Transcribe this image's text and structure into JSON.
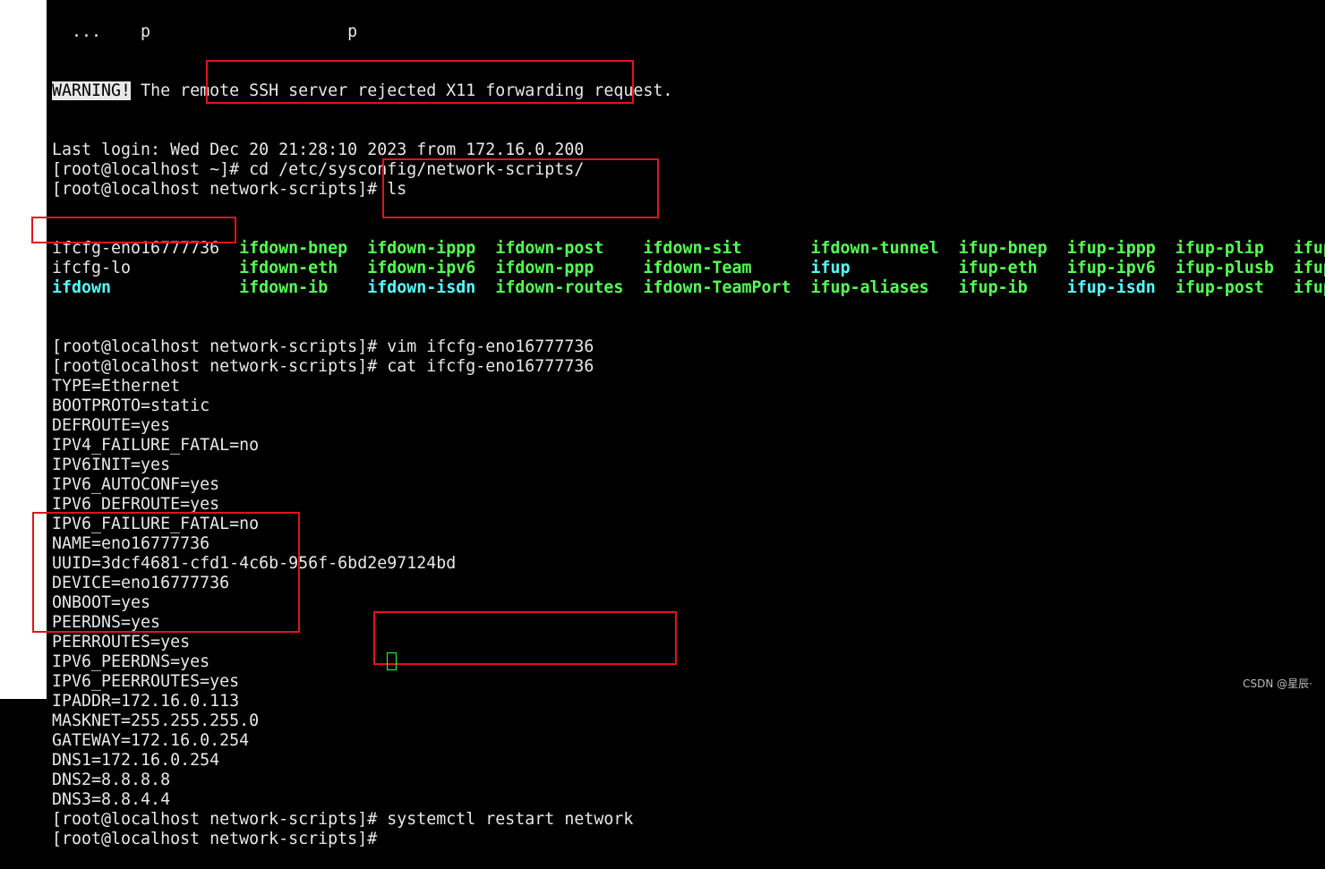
{
  "terminal": {
    "clipped_top_line": "  ...    p                    p",
    "warning_label": "WARNING!",
    "warning_text": " The remote SSH server rejected X11 forwarding request.",
    "lines_before_ls": [
      "Last login: Wed Dec 20 21:28:10 2023 from 172.16.0.200",
      "[root@localhost ~]# cd /etc/sysconfig/network-scripts/",
      "[root@localhost network-scripts]# ls"
    ],
    "ls_columns": [
      19,
      13,
      13,
      15,
      17,
      15,
      11,
      11,
      12,
      6
    ],
    "ls_rows": [
      [
        {
          "t": "ifcfg-eno16777736",
          "c": "n"
        },
        {
          "t": "ifdown-bnep",
          "c": "g"
        },
        {
          "t": "ifdown-ippp",
          "c": "g"
        },
        {
          "t": "ifdown-post",
          "c": "g"
        },
        {
          "t": "ifdown-sit",
          "c": "g"
        },
        {
          "t": "ifdown-tunnel",
          "c": "g"
        },
        {
          "t": "ifup-bnep",
          "c": "g"
        },
        {
          "t": "ifup-ippp",
          "c": "g"
        },
        {
          "t": "ifup-plip",
          "c": "g"
        },
        {
          "t": "ifup",
          "c": "g"
        }
      ],
      [
        {
          "t": "ifcfg-lo",
          "c": "n"
        },
        {
          "t": "ifdown-eth",
          "c": "g"
        },
        {
          "t": "ifdown-ipv6",
          "c": "g"
        },
        {
          "t": "ifdown-ppp",
          "c": "g"
        },
        {
          "t": "ifdown-Team",
          "c": "g"
        },
        {
          "t": "ifup",
          "c": "c"
        },
        {
          "t": "ifup-eth",
          "c": "g"
        },
        {
          "t": "ifup-ipv6",
          "c": "g"
        },
        {
          "t": "ifup-plusb",
          "c": "g"
        },
        {
          "t": "ifup",
          "c": "g"
        }
      ],
      [
        {
          "t": "ifdown",
          "c": "c"
        },
        {
          "t": "ifdown-ib",
          "c": "g"
        },
        {
          "t": "ifdown-isdn",
          "c": "c"
        },
        {
          "t": "ifdown-routes",
          "c": "g"
        },
        {
          "t": "ifdown-TeamPort",
          "c": "g"
        },
        {
          "t": "ifup-aliases",
          "c": "g"
        },
        {
          "t": "ifup-ib",
          "c": "g"
        },
        {
          "t": "ifup-isdn",
          "c": "c"
        },
        {
          "t": "ifup-post",
          "c": "g"
        },
        {
          "t": "ifup",
          "c": "g"
        }
      ]
    ],
    "lines_after_ls": [
      "[root@localhost network-scripts]# vim ifcfg-eno16777736",
      "[root@localhost network-scripts]# cat ifcfg-eno16777736",
      "TYPE=Ethernet",
      "BOOTPROTO=static",
      "DEFROUTE=yes",
      "IPV4_FAILURE_FATAL=no",
      "IPV6INIT=yes",
      "IPV6_AUTOCONF=yes",
      "IPV6_DEFROUTE=yes",
      "IPV6_FAILURE_FATAL=no",
      "NAME=eno16777736",
      "UUID=3dcf4681-cfd1-4c6b-956f-6bd2e97124bd",
      "DEVICE=eno16777736",
      "ONBOOT=yes",
      "PEERDNS=yes",
      "PEERROUTES=yes",
      "IPV6_PEERDNS=yes",
      "IPV6_PEERROUTES=yes",
      "IPADDR=172.16.0.113",
      "MASKNET=255.255.255.0",
      "GATEWAY=172.16.0.254",
      "DNS1=172.16.0.254",
      "DNS2=8.8.8.8",
      "DNS3=8.8.4.4",
      "[root@localhost network-scripts]# systemctl restart network",
      "[root@localhost network-scripts]# "
    ]
  },
  "colors": {
    "highlight_box": "#e0141e",
    "executable": "#55ff55",
    "link": "#55ffff",
    "background": "#000000"
  },
  "watermark": "CSDN @星辰·"
}
